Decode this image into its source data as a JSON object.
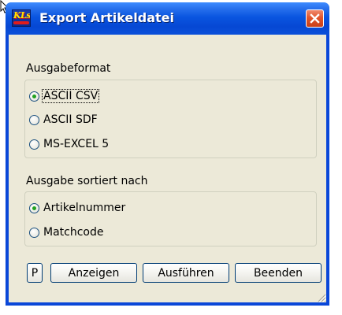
{
  "window": {
    "title": "Export Artikeldatei",
    "app_icon_text": "KLs"
  },
  "groups": {
    "format": {
      "label": "Ausgabeformat",
      "options": [
        {
          "label": "ASCII CSV",
          "selected": true
        },
        {
          "label": "ASCII SDF",
          "selected": false
        },
        {
          "label": "MS-EXCEL 5",
          "selected": false
        }
      ]
    },
    "sort": {
      "label": "Ausgabe sortiert nach",
      "options": [
        {
          "label": "Artikelnummer",
          "selected": true
        },
        {
          "label": "Matchcode",
          "selected": false
        }
      ]
    }
  },
  "buttons": {
    "p": "P",
    "show": "Anzeigen",
    "run": "Ausführen",
    "quit": "Beenden"
  },
  "icons": {
    "close": "close-icon",
    "app": "app-icon",
    "cursor": "mouse-cursor-icon",
    "grip": "resize-grip-icon"
  },
  "colors": {
    "titlebar": "#0a55e0",
    "client": "#ece9d8",
    "close_button": "#e2552b",
    "radio_dot": "#21a121"
  }
}
